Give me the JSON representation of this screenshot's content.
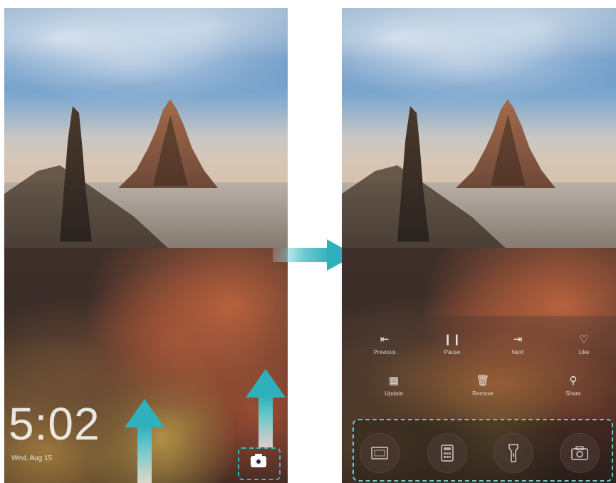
{
  "lock_screen": {
    "time": "5:02",
    "date": "Wed, Aug 15"
  },
  "controls": {
    "row1": [
      {
        "label": "Previous",
        "icon": "previous-icon"
      },
      {
        "label": "Pause",
        "icon": "pause-icon"
      },
      {
        "label": "Next",
        "icon": "next-icon"
      },
      {
        "label": "Like",
        "icon": "heart-icon"
      }
    ],
    "row2": [
      {
        "label": "Update",
        "icon": "calendar-icon"
      },
      {
        "label": "Remove",
        "icon": "trash-icon"
      },
      {
        "label": "Share",
        "icon": "share-icon"
      }
    ]
  },
  "shortcuts": [
    {
      "icon": "screen-recorder-icon"
    },
    {
      "icon": "calculator-icon"
    },
    {
      "icon": "flashlight-icon"
    },
    {
      "icon": "camera-icon"
    }
  ],
  "colors": {
    "accent_arrow": "#2fb0bd",
    "highlight_dash": "#6fc4cf"
  }
}
